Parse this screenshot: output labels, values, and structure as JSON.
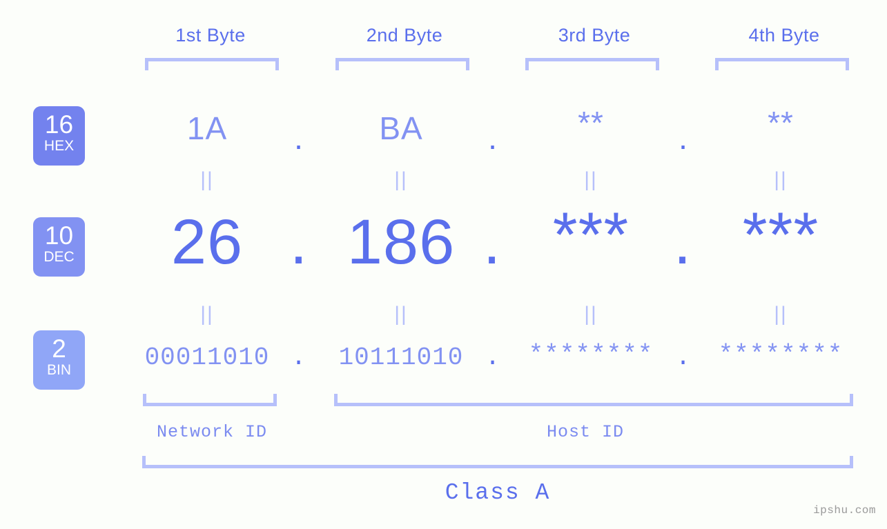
{
  "headers": [
    {
      "label": "1st Byte"
    },
    {
      "label": "2nd Byte"
    },
    {
      "label": "3rd Byte"
    },
    {
      "label": "4th Byte"
    }
  ],
  "bases": [
    {
      "num": "16",
      "name": "HEX",
      "color": "#7382ee"
    },
    {
      "num": "10",
      "name": "DEC",
      "color": "#8292f2"
    },
    {
      "num": "2",
      "name": "BIN",
      "color": "#90a6f7"
    }
  ],
  "rows": {
    "hex": {
      "values": [
        "1A",
        "BA",
        "**",
        "**"
      ]
    },
    "dec": {
      "values": [
        "26",
        "186",
        "***",
        "***"
      ]
    },
    "bin": {
      "values": [
        "00011010",
        "10111010",
        "********",
        "********"
      ]
    }
  },
  "separator": {
    "glyph": "||"
  },
  "dot": {
    "glyph": "."
  },
  "sections": {
    "network_id": "Network ID",
    "host_id": "Host ID",
    "class": "Class A"
  },
  "watermark": "ipshu.com",
  "colors": {
    "background": "#fcfefa",
    "bracket": "#b6c0fa",
    "accent_strong": "#5a6fec",
    "accent_light": "#8292f2"
  }
}
